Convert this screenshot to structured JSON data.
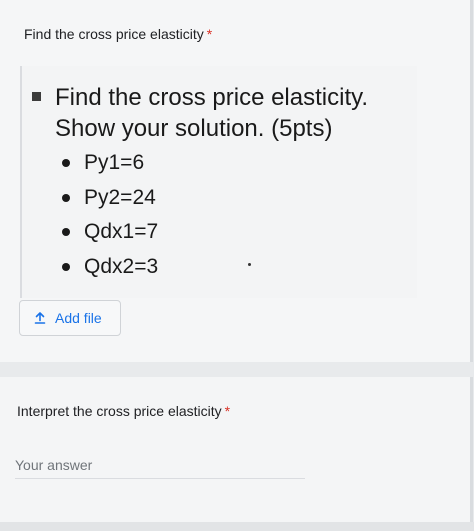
{
  "question1": {
    "title": "Find the cross price elasticity",
    "required_marker": "*",
    "image": {
      "heading_line1": "Find the cross price elasticity.",
      "heading_line2": "Show your solution. (5pts)",
      "items": [
        "Py1=6",
        "Py2=24",
        "Qdx1=7",
        "Qdx2=3"
      ]
    },
    "add_file_label": "Add file",
    "add_file_icon": "upload-icon"
  },
  "question2": {
    "title": "Interpret the cross price elasticity",
    "required_marker": "*",
    "answer_placeholder": "Your answer"
  },
  "colors": {
    "accent": "#1a73e8",
    "required": "#d93025",
    "card_background": "#f5f6f7",
    "page_background": "#e8eaec"
  }
}
